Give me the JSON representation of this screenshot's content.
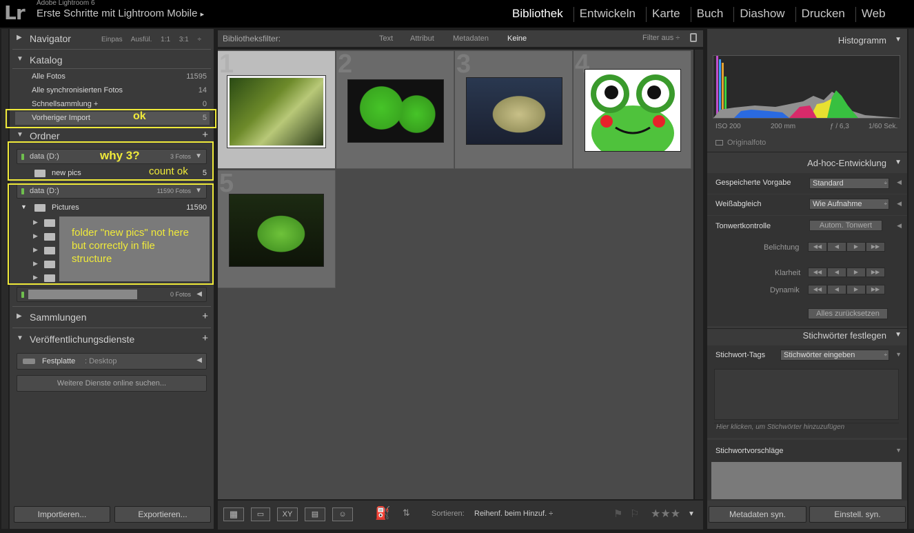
{
  "app": {
    "version": "Adobe Lightroom 6",
    "catalog_title": "Erste Schritte mit Lightroom Mobile",
    "title_arrow": "▸"
  },
  "modules": [
    "Bibliothek",
    "Entwickeln",
    "Karte",
    "Buch",
    "Diashow",
    "Drucken",
    "Web"
  ],
  "left": {
    "navigator": {
      "label": "Navigator",
      "options": "Einpas Ausfül. 1:1 3:1 ÷"
    },
    "catalog": {
      "label": "Katalog",
      "rows": [
        {
          "label": "Alle Fotos",
          "count": "11595"
        },
        {
          "label": "Alle synchronisierten Fotos",
          "count": "14"
        },
        {
          "label": "Schnellsammlung +",
          "count": "0"
        },
        {
          "label": "Vorheriger Import",
          "count": "5"
        }
      ]
    },
    "folders": {
      "label": "Ordner",
      "vol1": {
        "name": "data (D:)",
        "count": "3 Fotos"
      },
      "vol1_child": {
        "name": "new pics",
        "count": "5"
      },
      "vol2": {
        "name": "data (D:)",
        "count": "11590 Fotos"
      },
      "vol2_child": {
        "name": "Pictures",
        "count": "11590"
      },
      "vol3": {
        "count": "0 Fotos"
      }
    },
    "collections": {
      "label": "Sammlungen"
    },
    "publish": {
      "label": "Veröffentlichungsdienste",
      "service": "Festplatte",
      "service_sub": ": Desktop",
      "find_more": "Weitere Dienste online suchen..."
    },
    "import_btn": "Importieren...",
    "export_btn": "Exportieren..."
  },
  "annotations": {
    "ok": "ok",
    "why": "why 3?",
    "count_ok": "count ok",
    "folder_note": "folder \"new pics\" not here but correctly in file structure"
  },
  "filterbar": {
    "label": "Bibliotheksfilter:",
    "tabs": [
      "Text",
      "Attribut",
      "Metadaten",
      "Keine"
    ],
    "active": "Keine",
    "filter_off": "Filter aus ÷"
  },
  "grid": {
    "cells": [
      "1",
      "2",
      "3",
      "4",
      "5"
    ]
  },
  "toolbar": {
    "sort_label": "Sortieren:",
    "sort_value": "Reihenf. beim Hinzuf. ÷"
  },
  "right": {
    "histogram": {
      "label": "Histogramm",
      "iso": "ISO 200",
      "focal": "200 mm",
      "aperture": "ƒ / 6,3",
      "shutter": "1/60 Sek.",
      "original": "Originalfoto"
    },
    "quick_develop": {
      "label": "Ad-hoc-Entwicklung",
      "preset_label": "Gespeicherte Vorgabe",
      "preset_value": "Standard",
      "wb_label": "Weißabgleich",
      "wb_value": "Wie Aufnahme",
      "tone_label": "Tonwertkontrolle",
      "auto_tone": "Autom. Tonwert",
      "exposure": "Belichtung",
      "clarity": "Klarheit",
      "vibrance": "Dynamik",
      "reset": "Alles zurücksetzen"
    },
    "keywording": {
      "label": "Stichwörter festlegen",
      "tags_label": "Stichwort-Tags",
      "tags_value": "Stichwörter eingeben",
      "hint": "Hier klicken, um Stichwörter hinzuzufügen",
      "suggestions": "Stichwortvorschläge"
    },
    "sync_meta": "Metadaten syn.",
    "sync_settings": "Einstell. syn."
  }
}
